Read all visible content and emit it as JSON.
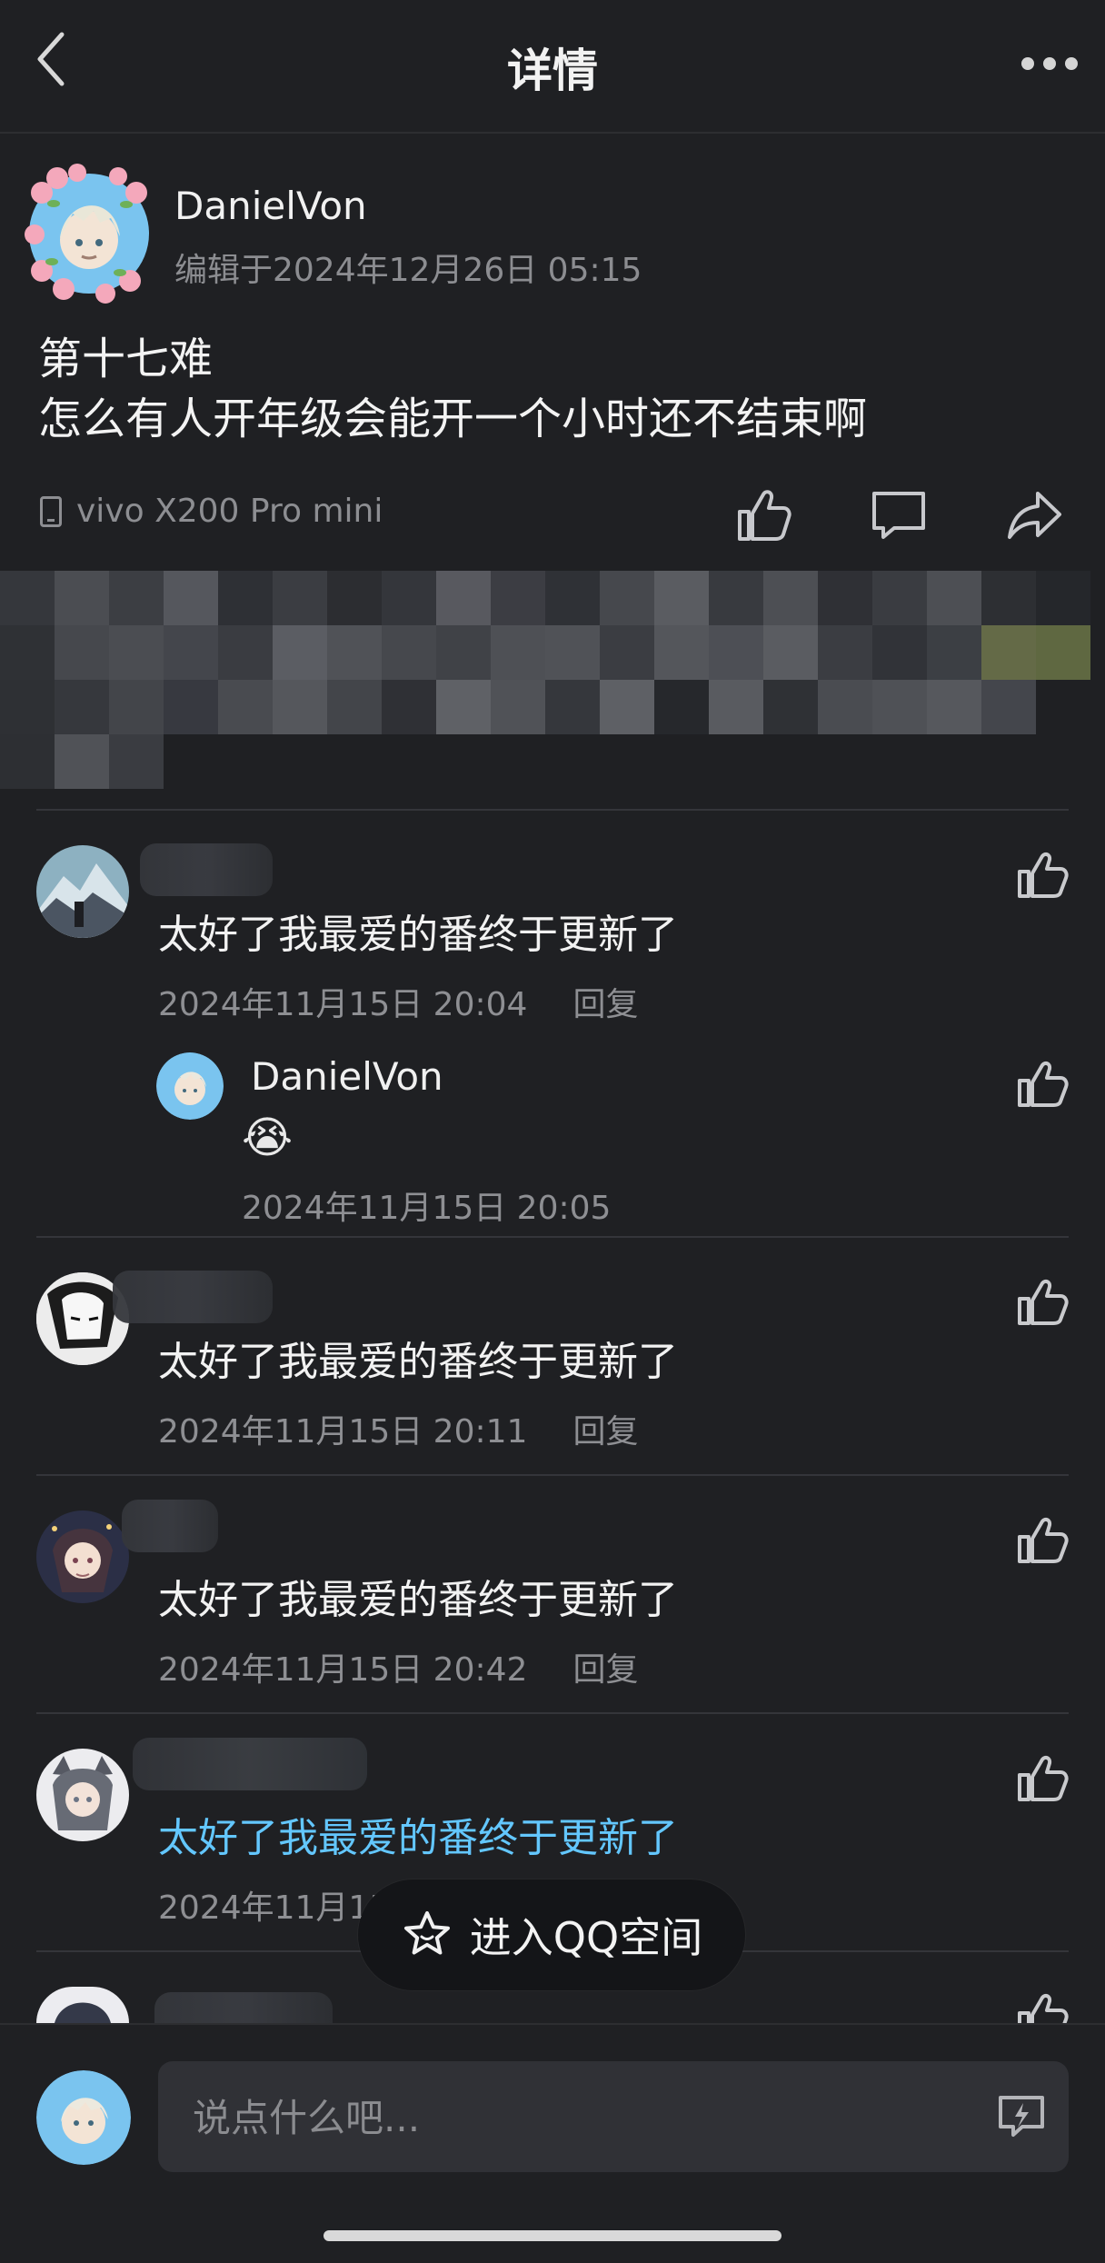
{
  "header": {
    "title": "详情",
    "back_icon": "chevron-left-icon",
    "more_icon": "more-horizontal-icon"
  },
  "post": {
    "author": "DanielVon",
    "edited_time": "编辑于2024年12月26日 05:15",
    "text": "第十七难\n怎么有人开年级会能开一个小时还不结束啊",
    "device": "vivo X200 Pro mini",
    "actions": [
      "like-icon",
      "comment-icon",
      "share-icon"
    ]
  },
  "comments": [
    {
      "text": "太好了我最爱的番终于更新了",
      "time": "2024年11月15日 20:04",
      "reply_label": "回复",
      "reply": {
        "author": "DanielVon",
        "emoji": "😭",
        "time": "2024年11月15日 20:05"
      }
    },
    {
      "text": "太好了我最爱的番终于更新了",
      "time": "2024年11月15日 20:11",
      "reply_label": "回复"
    },
    {
      "text": "太好了我最爱的番终于更新了",
      "time": "2024年11月15日 20:42",
      "reply_label": "回复"
    },
    {
      "text": "太好了我最爱的番终于更新了",
      "time": "2024年11月15日",
      "text_color": "#63c7ff"
    }
  ],
  "floating_button": {
    "label": "进入QQ空间",
    "icon": "star-outline-icon"
  },
  "composer": {
    "placeholder": "说点什么吧...",
    "emoji_icon": "emoji-panel-icon"
  },
  "colors": {
    "background": "#1f2023",
    "divider": "#34353a",
    "highlight_text": "#63c7ff",
    "muted_text": "#8e8f93"
  }
}
